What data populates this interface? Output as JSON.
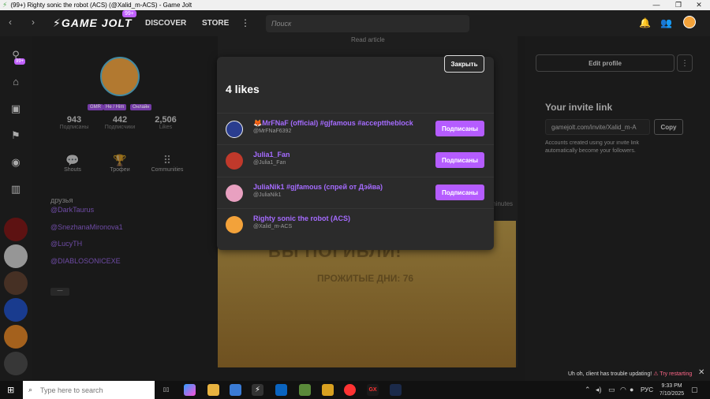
{
  "window": {
    "title": "(99+) Righty sonic the robot (ACS) (@Xalid_m-ACS) - Game Jolt"
  },
  "nav": {
    "logo": "GAME JOLT",
    "badge": "99+",
    "discover": "DISCOVER",
    "store": "STORE",
    "search_placeholder": "Поиск"
  },
  "sidebar": {
    "badge": "99+"
  },
  "profile": {
    "tags": [
      "GMR",
      "He / Him",
      "Онлайн"
    ],
    "stats": [
      {
        "value": "943",
        "label": "Подписаны"
      },
      {
        "value": "442",
        "label": "Подписчики"
      },
      {
        "value": "2,506",
        "label": "Likes"
      }
    ],
    "items": [
      {
        "label": "Shouts",
        "icon": "speech-bubble-icon"
      },
      {
        "label": "Трофеи",
        "icon": "trophy-icon"
      },
      {
        "label": "Communities",
        "icon": "communities-icon"
      }
    ],
    "friends_title": "друзья",
    "friends": [
      "@DarkTaurus",
      "@SnezhanaMironova1",
      "@LucyTH",
      "@DIABLOSONICEXE"
    ],
    "more_label": "—"
  },
  "feed": {
    "read_article": "Read article",
    "game_title": "ВЫ ПОГИБЛИ!",
    "game_days": "ПРОЖИТЫЕ ДНИ: 76",
    "minutes": "minutes"
  },
  "right": {
    "edit_profile": "Edit profile",
    "more": "⋮",
    "invite_title": "Your invite link",
    "invite_link": "gamejolt.com/invite/Xalid_m-A",
    "copy": "Copy",
    "invite_desc": "Accounts created using your invite link automatically become your followers."
  },
  "modal": {
    "close": "Закрыть",
    "title": "4 likes",
    "likes": [
      {
        "name": "MrFNaF (official) #gjfamous #accepttheblock",
        "user": "@MrFNaF6392",
        "button": "Подписаны",
        "color": "#2a3d8f"
      },
      {
        "name": "Julia1_Fan",
        "user": "@Julia1_Fan",
        "button": "Подписаны",
        "color": "#c0392b"
      },
      {
        "name": "JuliaNik1 #gjfamous (спрей от Дэйва)",
        "user": "@JuliaNik1",
        "button": "Подписаны",
        "color": "#e8a0c0"
      },
      {
        "name": "Righty sonic the robot (ACS)",
        "user": "@Xalid_m-ACS",
        "button": "",
        "color": "#f3a23a"
      }
    ]
  },
  "toast": {
    "text": "Uh oh, client has trouble updating!",
    "action": "Try restarting"
  },
  "taskbar": {
    "search_placeholder": "Type here to search",
    "lang": "РУС",
    "time": "9:33 PM",
    "date": "7/10/2025"
  },
  "colors": {
    "accent": "#b55cff",
    "link": "#a56bff",
    "modal_bg": "#2b2b2b"
  }
}
